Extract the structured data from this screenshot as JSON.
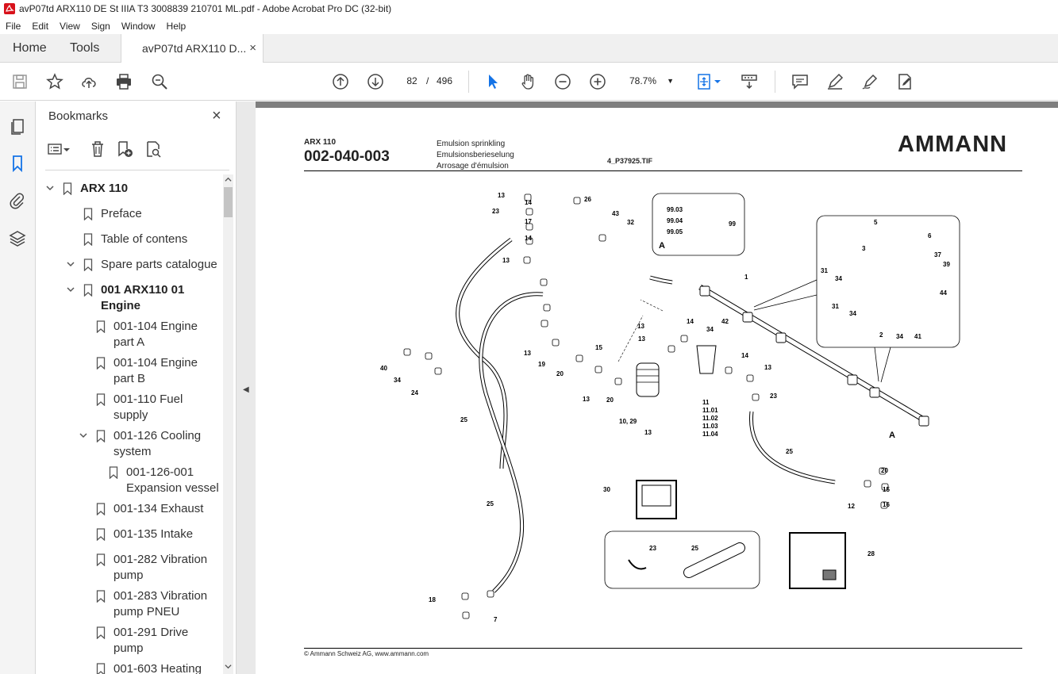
{
  "window": {
    "title": "avP07td ARX110 DE St IIIA T3 3008839 210701 ML.pdf - Adobe Acrobat Pro DC (32-bit)"
  },
  "menu": [
    "File",
    "Edit",
    "View",
    "Sign",
    "Window",
    "Help"
  ],
  "tabs": {
    "home": "Home",
    "tools": "Tools",
    "document": "avP07td ARX110 D...",
    "close": "×"
  },
  "toolbar": {
    "page_current": "82",
    "page_sep": "/",
    "page_total": "496",
    "zoom": "78.7%"
  },
  "bookmarks": {
    "title": "Bookmarks",
    "close": "×",
    "items": [
      {
        "label": "ARX 110",
        "level": 0,
        "bold": true,
        "expanded": true
      },
      {
        "label": "Preface",
        "level": 1
      },
      {
        "label": "Table of contens",
        "level": 1
      },
      {
        "label": "Spare parts catalogue",
        "level": 1,
        "expanded": true
      },
      {
        "label": "001 ARX110 01",
        "label2": "Engine",
        "level": 2,
        "bold": true,
        "expanded": true
      },
      {
        "label": "001-104 Engine",
        "label2": "part A",
        "level": 3
      },
      {
        "label": "001-104 Engine",
        "label2": "part B",
        "level": 3
      },
      {
        "label": "001-110 Fuel",
        "label2": "supply",
        "level": 3
      },
      {
        "label": "001-126 Cooling",
        "label2": "system",
        "level": 3,
        "expanded": true
      },
      {
        "label": "001-126-001",
        "label2": "Expansion vessel",
        "level": 4
      },
      {
        "label": "001-134 Exhaust",
        "level": 3
      },
      {
        "label": "001-135 Intake",
        "level": 3
      },
      {
        "label": "001-282 Vibration",
        "label2": "pump",
        "level": 3
      },
      {
        "label": "001-283 Vibration",
        "label2": "pump PNEU",
        "level": 3
      },
      {
        "label": "001-291 Drive",
        "label2": "pump",
        "level": 3
      },
      {
        "label": "001-603 Heating",
        "level": 3
      }
    ]
  },
  "document": {
    "model": "ARX 110",
    "code": "002-040-003",
    "desc_en": "Emulsion sprinkling",
    "desc_de": "Emulsionsberieselung",
    "desc_fr": "Arrosage d'émulsion",
    "image_ref": "4_P37925.TIF",
    "logo": "AMMANN",
    "footer": "© Ammann Schweiz AG, www.ammann.com",
    "callouts": [
      "13",
      "14",
      "17",
      "14",
      "13",
      "23",
      "26",
      "43",
      "32",
      "99.03",
      "99.04",
      "99.05",
      "99",
      "A",
      "1",
      "5",
      "6",
      "3",
      "37",
      "39",
      "31",
      "34",
      "31",
      "34",
      "44",
      "2",
      "34",
      "41",
      "13",
      "13",
      "15",
      "13",
      "19",
      "20",
      "13",
      "20",
      "10, 29",
      "13",
      "14",
      "34",
      "42",
      "14",
      "13",
      "23",
      "11",
      "11.01",
      "11.02",
      "11.03",
      "11.04",
      "A",
      "40",
      "34",
      "24",
      "25",
      "25",
      "25",
      "20",
      "15",
      "12",
      "16",
      "30",
      "23",
      "25",
      "28",
      "18",
      "7"
    ]
  }
}
